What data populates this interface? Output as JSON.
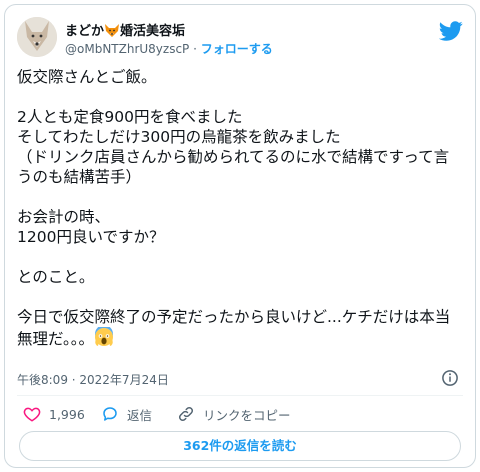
{
  "author": {
    "name_prefix": "まどか",
    "name_suffix": "婚活美容垢",
    "handle": "@oMbNTZhrU8yzscP",
    "separator": "·",
    "follow_label": "フォローする"
  },
  "tweet": {
    "text": "仮交際さんとご飯。\n\n2人とも定食900円を食べました\nそしてわたしだけ300円の烏龍茶を飲みました\n（ドリンク店員さんから勧められてるのに水で結構ですって言うのも結構苦手）\n\nお会計の時、\n1200円良いですか？\n\nとのこと。\n\n今日で仮交際終了の予定だったから良いけど...ケチだけは本当無理だ。。。",
    "timestamp": "午後8:09 · 2022年7月24日"
  },
  "actions": {
    "like_count": "1,996",
    "reply_label": "返信",
    "copy_link_label": "リンクをコピー"
  },
  "read_replies_label": "362件の返信を読む",
  "icons": {
    "fox": "fox-emoji-icon",
    "scream": "scream-emoji-icon",
    "bird": "twitter-bird-icon",
    "info": "info-icon",
    "heart": "heart-icon",
    "reply": "reply-bubble-icon",
    "link": "link-icon"
  },
  "colors": {
    "accent": "#1d9bf0",
    "like": "#f91880",
    "muted": "#536471"
  }
}
